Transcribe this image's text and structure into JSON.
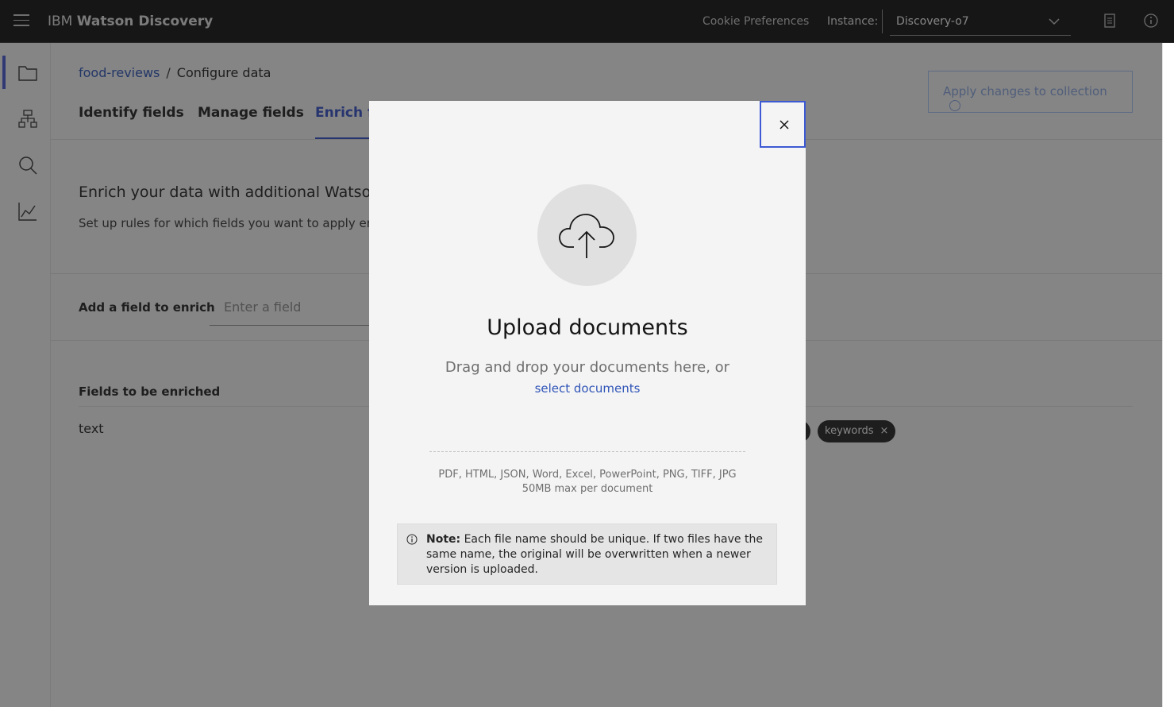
{
  "header": {
    "brand_prefix": "IBM",
    "brand_name": "Watson Discovery",
    "cookie_label": "Cookie Preferences",
    "instance_label": "Instance:",
    "instance_value": "Discovery-o7"
  },
  "breadcrumb": {
    "link": "food-reviews",
    "separator": "/",
    "current": "Configure data"
  },
  "apply_button": "Apply changes to collection",
  "tabs": [
    {
      "label": "Identify fields"
    },
    {
      "label": "Manage fields"
    },
    {
      "label": "Enrich fi"
    }
  ],
  "enrich": {
    "title": "Enrich your data with additional Watson in",
    "subtitle": "Set up rules for which fields you want to apply enric",
    "add_label": "Add a field to enrich",
    "add_placeholder": "Enter a field",
    "fields_label": "Fields to be enriched",
    "field_name": "text",
    "tags": [
      "keywords"
    ]
  },
  "modal": {
    "title": "Upload documents",
    "drag_text": "Drag and drop your documents here, or",
    "select_link": "select documents",
    "formats": "PDF, HTML, JSON, Word, Excel, PowerPoint, PNG, TIFF, JPG",
    "max_size": "50MB max per document",
    "note_bold": "Note:",
    "note_text": " Each file name should be unique. If two files have the same name, the original will be overwritten when a newer version is uploaded."
  },
  "colors": {
    "accent": "#3854c8",
    "header_bg": "#161616",
    "link": "#3156b8"
  }
}
